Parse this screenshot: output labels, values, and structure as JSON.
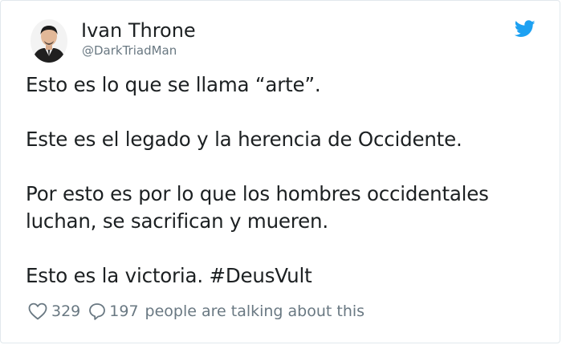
{
  "author": {
    "name": "Ivan Throne",
    "handle": "@DarkTriadMan"
  },
  "tweet": {
    "line1": "Esto es lo que se llama “arte”.",
    "line2": "Este es el legado y la herencia de Occidente.",
    "line3": "Por esto es por lo que los hombres occidentales",
    "line4": "luchan, se sacrifican y mueren.",
    "line5": "Esto es la victoria. #DeusVult"
  },
  "actions": {
    "likes": "329",
    "replies": "197",
    "talking_label": "people are talking about this"
  },
  "icons": {
    "brand": "twitter-bird-icon",
    "like": "heart-icon",
    "reply": "speech-bubble-icon"
  },
  "colors": {
    "brand": "#1da1f2",
    "text": "#1c2022",
    "muted": "#697882",
    "border": "#e1e8ed"
  }
}
